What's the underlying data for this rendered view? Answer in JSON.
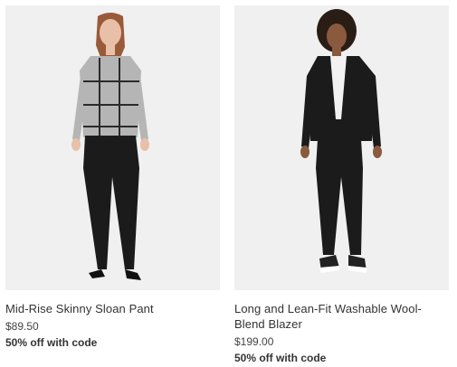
{
  "products": [
    {
      "name": "Mid-Rise Skinny Sloan Pant",
      "price": "$89.50",
      "promo": "50% off with code",
      "image": "woman-in-plaid-sweater-and-black-pants"
    },
    {
      "name": "Long and Lean-Fit Washable Wool-Blend Blazer",
      "price": "$199.00",
      "promo": "50% off with code",
      "image": "woman-in-black-blazer-suit"
    }
  ],
  "colors": {
    "photo_background": "#f0f0f0",
    "garment_black": "#1b1b1b",
    "sweater_grey": "#b5b5b5"
  }
}
